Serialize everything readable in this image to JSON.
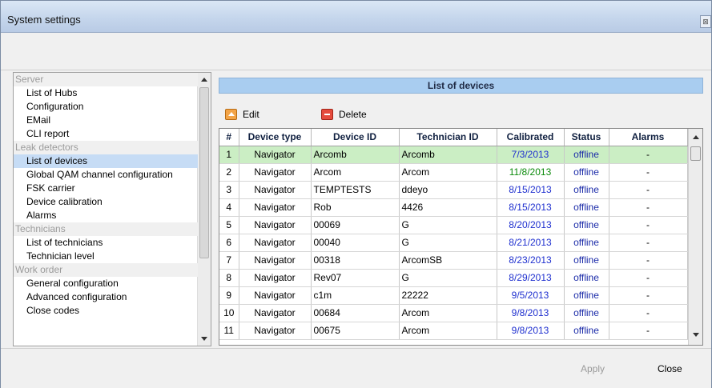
{
  "window": {
    "title": "System settings"
  },
  "tree": {
    "groups": [
      {
        "label": "Server",
        "items": [
          "List of Hubs",
          "Configuration",
          "EMail",
          "CLI report"
        ]
      },
      {
        "label": "Leak detectors",
        "items": [
          "List of devices",
          "Global QAM channel configuration",
          "FSK carrier",
          "Device calibration",
          "Alarms"
        ]
      },
      {
        "label": "Technicians",
        "items": [
          "List of technicians",
          "Technician level"
        ]
      },
      {
        "label": "Work order",
        "items": [
          "General configuration",
          "Advanced configuration",
          "Close codes"
        ]
      }
    ],
    "selected": "List of devices"
  },
  "list": {
    "header": "List of devices",
    "edit_label": "Edit",
    "delete_label": "Delete",
    "columns": [
      "#",
      "Device type",
      "Device ID",
      "Technician ID",
      "Calibrated",
      "Status",
      "Alarms"
    ],
    "rows": [
      [
        "1",
        "Navigator",
        "Arcomb",
        "Arcomb",
        "7/3/2013",
        "offline",
        "-"
      ],
      [
        "2",
        "Navigator",
        "Arcom",
        "Arcom",
        "11/8/2013",
        "offline",
        "-"
      ],
      [
        "3",
        "Navigator",
        "TEMPTESTS",
        "ddeyo",
        "8/15/2013",
        "offline",
        "-"
      ],
      [
        "4",
        "Navigator",
        "Rob",
        "4426",
        "8/15/2013",
        "offline",
        "-"
      ],
      [
        "5",
        "Navigator",
        "00069",
        "G",
        "8/20/2013",
        "offline",
        "-"
      ],
      [
        "6",
        "Navigator",
        "00040",
        "G",
        "8/21/2013",
        "offline",
        "-"
      ],
      [
        "7",
        "Navigator",
        "00318",
        "ArcomSB",
        "8/23/2013",
        "offline",
        "-"
      ],
      [
        "8",
        "Navigator",
        "Rev07",
        "G",
        "8/29/2013",
        "offline",
        "-"
      ],
      [
        "9",
        "Navigator",
        "c1m",
        "22222",
        "9/5/2013",
        "offline",
        "-"
      ],
      [
        "10",
        "Navigator",
        "00684",
        "Arcom",
        "9/8/2013",
        "offline",
        "-"
      ],
      [
        "11",
        "Navigator",
        "00675",
        "Arcom",
        "9/8/2013",
        "offline",
        "-"
      ]
    ],
    "highlight_color": "#cbeec4",
    "calibrated_color": "#1e2fcf",
    "calibrated_recent_color": "#0b8a0b"
  },
  "footer": {
    "apply_label": "Apply",
    "close_label": "Close"
  },
  "icons": {
    "edit": "edit-icon",
    "delete": "delete-icon",
    "window_close": "close-icon"
  }
}
